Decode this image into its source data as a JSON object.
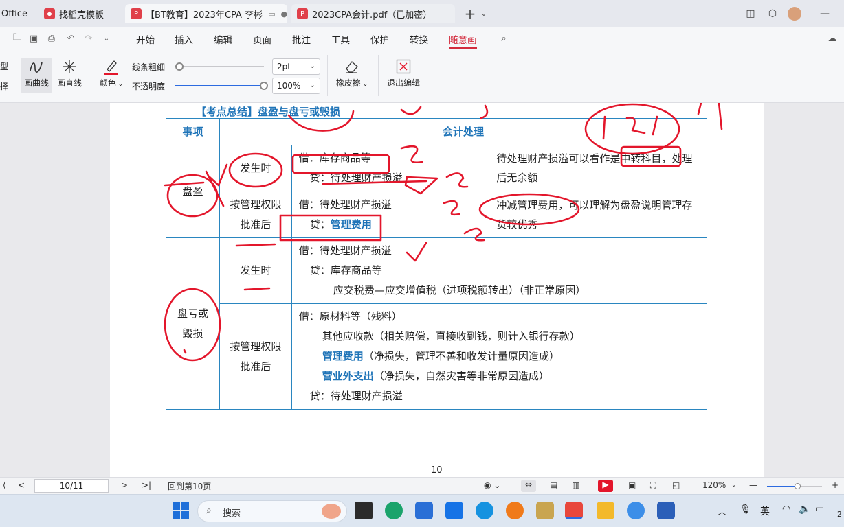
{
  "tabs": [
    {
      "label": "Office"
    },
    {
      "label": "找稻壳模板"
    },
    {
      "label": "【BT教育】2023年CPA 李彬"
    },
    {
      "label": "2023CPA会计.pdf（已加密）"
    }
  ],
  "menu": [
    "开始",
    "插入",
    "编辑",
    "页面",
    "批注",
    "工具",
    "保护",
    "转换",
    "随意画"
  ],
  "toolbar": {
    "left_cut_top": "型",
    "left_cut_bottom": "择",
    "curve": "画曲线",
    "line": "画直线",
    "color": "颜色",
    "thickness_label": "线条粗细",
    "thickness_value": "2pt",
    "opacity_label": "不透明度",
    "opacity_value": "100%",
    "opacity_level": 1.0,
    "thickness_level": 0.05,
    "eraser": "橡皮擦",
    "exit": "退出编辑"
  },
  "doc": {
    "heading": "【考点总结】盘盈与盘亏或毁损",
    "page_number": "10",
    "table": {
      "head_item": "事项",
      "head_process": "会计处理",
      "surplus": "盘盈",
      "loss_a": "盘亏或",
      "loss_b": "毁损",
      "occur": "发生时",
      "approved_a": "按管理权限",
      "approved_b": "批准后",
      "r1_l1": "借：库存商品等",
      "r1_l2": "贷：待处理财产损溢",
      "r1_note": "待处理财产损溢可以看作是中转科目，处理后无余额",
      "r2_l1": "借：待处理财产损溢",
      "r2_l2_prefix": "贷：",
      "r2_l2_blue": "管理费用",
      "r2_note": "冲减管理费用，可以理解为盘盈说明管理存货较优秀",
      "r3_l1": "借：待处理财产损溢",
      "r3_l2": "贷：库存商品等",
      "r3_l3": "应交税费—应交增值税（进项税额转出）（非正常原因）",
      "r4_l1": "借：原材料等（残料）",
      "r4_l2": "其他应收款（相关赔偿，直接收到钱，则计入银行存款）",
      "r4_l3_blue": "管理费用",
      "r4_l3": "（净损失，管理不善和收发计量原因造成）",
      "r4_l4_blue": "营业外支出",
      "r4_l4": "（净损失，自然灾害等非常原因造成）",
      "r4_l5": "贷：待处理财产损溢"
    }
  },
  "status": {
    "page_input": "10/11",
    "back_label": "回到第10页",
    "zoom": "120%",
    "zoom_level": 0.55
  },
  "taskbar": {
    "search_placeholder": "搜索",
    "ime": "英",
    "clock_cut": "2"
  },
  "colors": {
    "accent": "#d32b3d",
    "table_blue": "#1f74b8",
    "ink_red": "#e3162b"
  }
}
